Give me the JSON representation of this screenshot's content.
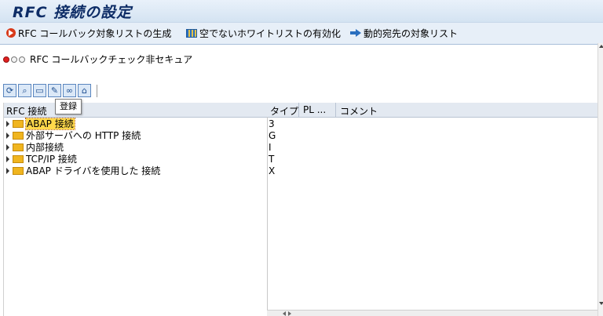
{
  "window": {
    "title": "RFC 接続の設定"
  },
  "toolbar": {
    "items": [
      {
        "label": "RFC コールバック対象リストの生成",
        "icon": "execute-icon"
      },
      {
        "label": "空でないホワイトリストの有効化",
        "icon": "whitelist-icon"
      },
      {
        "label": "動的宛先の対象リスト",
        "icon": "arrow-right-icon"
      }
    ]
  },
  "status": {
    "text": "RFC コールバックチェック非セキュア",
    "traffic_light": "red"
  },
  "icon_toolbar": {
    "buttons": [
      "refresh-icon",
      "find-icon",
      "create-icon",
      "edit-icon",
      "glasses-icon",
      "delete-icon"
    ],
    "tooltip": "登録"
  },
  "tree": {
    "columns": [
      "RFC 接続",
      "タイプ",
      "PL ...",
      "コメント"
    ],
    "rows": [
      {
        "label": "ABAP 接続",
        "type": "3"
      },
      {
        "label": "外部サーバへの HTTP 接続",
        "type": "G"
      },
      {
        "label": "内部接続",
        "type": "I"
      },
      {
        "label": "TCP/IP 接続",
        "type": "T"
      },
      {
        "label": "ABAP ドライバを使用した 接続",
        "type": "X"
      }
    ]
  },
  "colors": {
    "title": "#0d2c66",
    "folder": "#f0b51f",
    "selection": "#ffd84a",
    "status_red": "#e02020"
  }
}
